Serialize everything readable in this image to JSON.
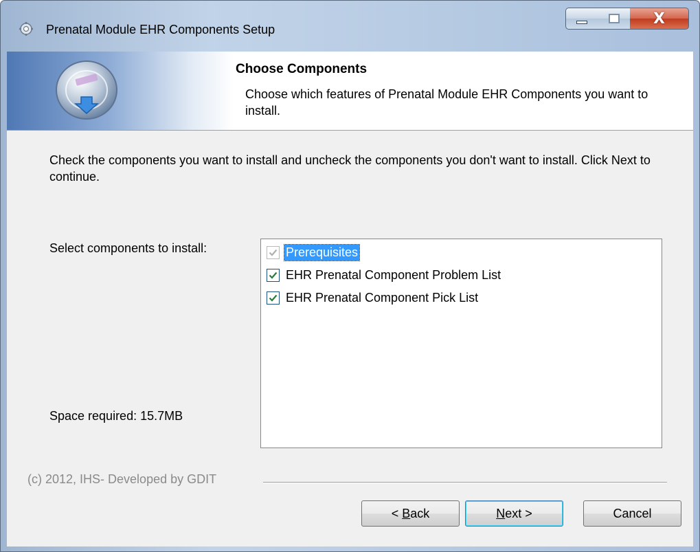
{
  "window": {
    "title": "Prenatal Module EHR Components Setup",
    "close_glyph": "X"
  },
  "header": {
    "title": "Choose Components",
    "subtitle": "Choose which features of Prenatal Module EHR Components you want to install."
  },
  "body": {
    "instructions": "Check the components you want to install and uncheck the components you don't want to install. Click Next to continue.",
    "select_label": "Select components to install:",
    "space_required": "Space required: 15.7MB"
  },
  "components": [
    {
      "label": "Prerequisites",
      "checked": true,
      "disabled": true,
      "selected": true
    },
    {
      "label": "EHR Prenatal Component Problem List",
      "checked": true,
      "disabled": false,
      "selected": false
    },
    {
      "label": "EHR Prenatal Component Pick List",
      "checked": true,
      "disabled": false,
      "selected": false
    }
  ],
  "footer": {
    "branding": "(c) 2012, IHS- Developed by GDIT"
  },
  "buttons": {
    "back_prefix": "< ",
    "back_accel": "B",
    "back_rest": "ack",
    "next_accel": "N",
    "next_rest": "ext >",
    "cancel": "Cancel"
  },
  "colors": {
    "selection": "#3399ff",
    "check": "#2a7a3a",
    "check_disabled": "#b0b0b0"
  }
}
